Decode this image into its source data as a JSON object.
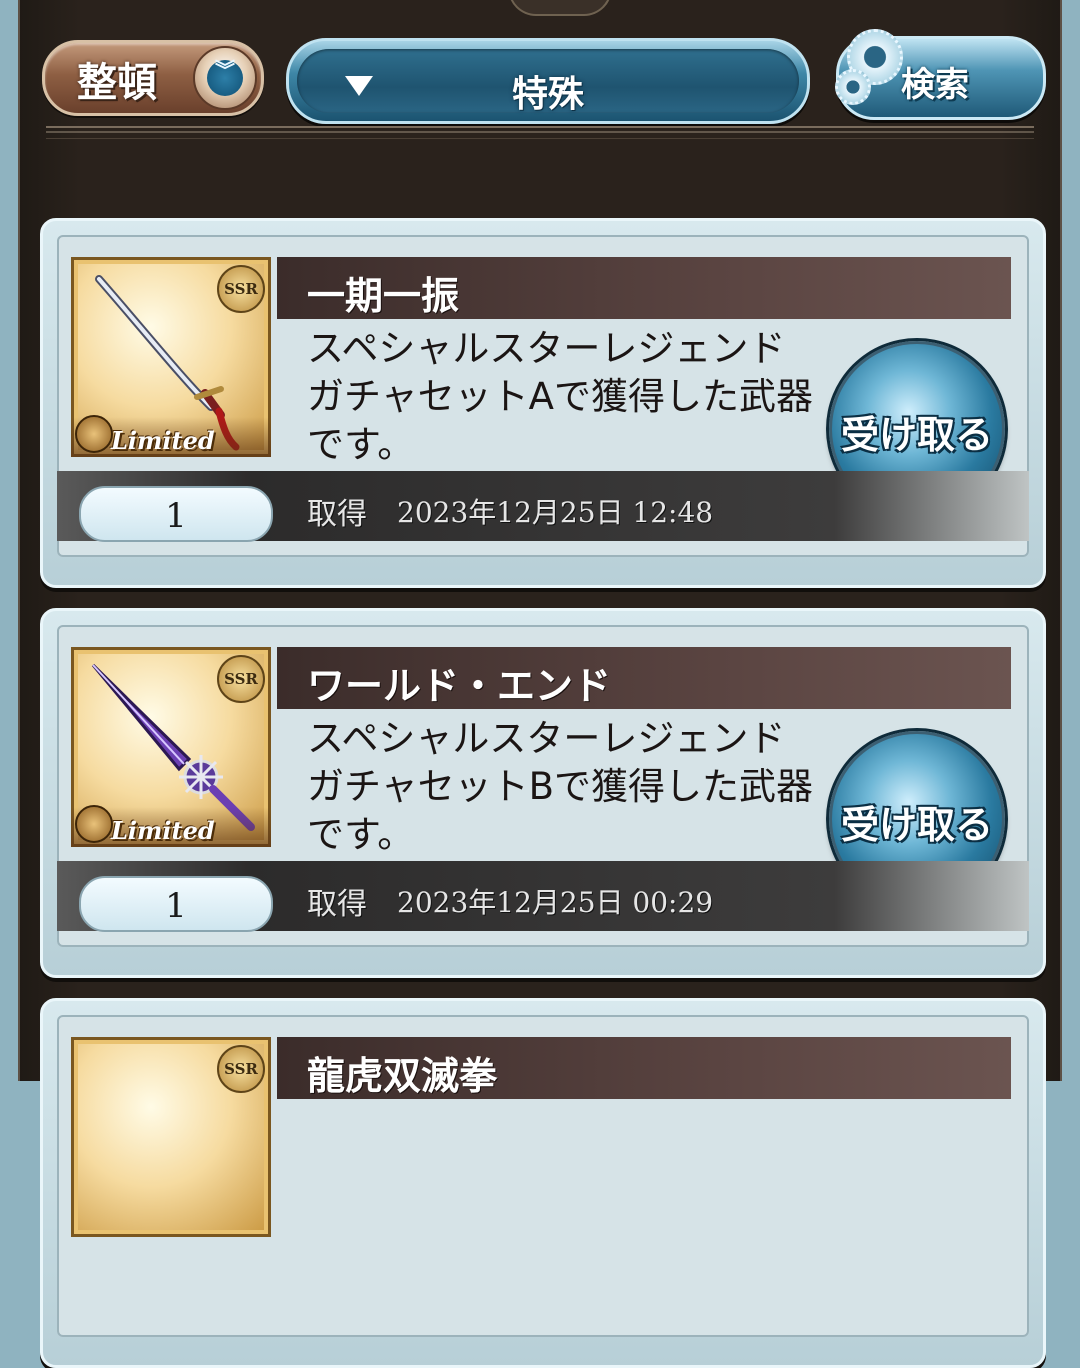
{
  "toolbar": {
    "sort_label": "整頓",
    "sort_icon": "sort-chevrons-icon",
    "filter_label": "特殊",
    "search_label": "検索"
  },
  "items": [
    {
      "name": "一期一振",
      "rarity": "SSR",
      "tag": "Limited",
      "description": "スペシャルスターレジェンドガチャセットAで獲得した武器です。",
      "receive_label": "受け取る",
      "quantity": "1",
      "acquired_label": "取得",
      "acquired_date": "2023年12月25日  12:48"
    },
    {
      "name": "ワールド・エンド",
      "rarity": "SSR",
      "tag": "Limited",
      "description": "スペシャルスターレジェンドガチャセットBで獲得した武器です。",
      "receive_label": "受け取る",
      "quantity": "1",
      "acquired_label": "取得",
      "acquired_date": "2023年12月25日  00:29"
    },
    {
      "name": "龍虎双滅拳",
      "rarity": "SSR"
    }
  ],
  "colors": {
    "frame_bg": "#2a221c",
    "card_bg": "#d6e3e7",
    "name_bar": "#3b2c2a",
    "accent_blue": "#2a7aa0",
    "sort_brown": "#8e5f43"
  }
}
